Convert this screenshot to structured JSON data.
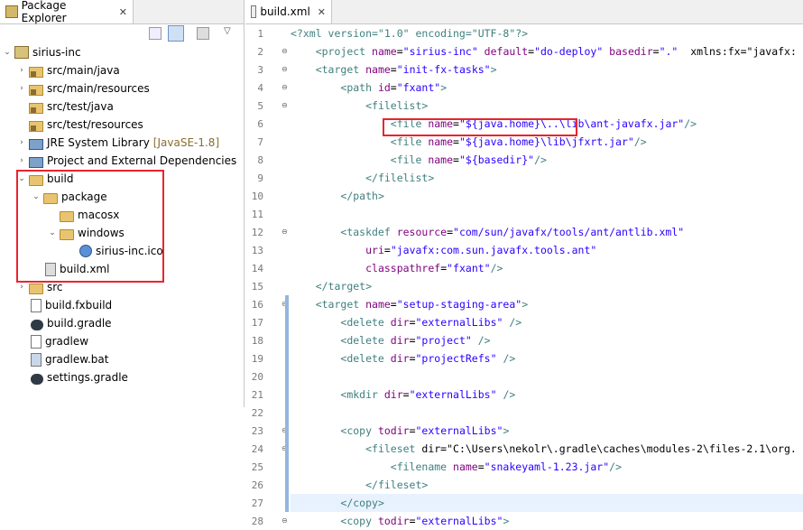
{
  "explorer": {
    "tab_label": "Package Explorer",
    "tab_close": "✕",
    "project": "sirius-inc",
    "items": [
      {
        "label": "src/main/java",
        "icon": "package-folder-icon",
        "chevron": "›"
      },
      {
        "label": "src/main/resources",
        "icon": "package-folder-icon",
        "chevron": "›"
      },
      {
        "label": "src/test/java",
        "icon": "package-folder-icon",
        "chevron": ""
      },
      {
        "label": "src/test/resources",
        "icon": "package-folder-icon",
        "chevron": ""
      },
      {
        "label": "JRE System Library",
        "suffix": "[JavaSE-1.8]",
        "icon": "library-icon",
        "chevron": "›"
      },
      {
        "label": "Project and External Dependencies",
        "icon": "library-icon",
        "chevron": "›"
      },
      {
        "label": "build",
        "icon": "folder-icon",
        "chevron": "⌄"
      },
      {
        "label": "package",
        "icon": "folder-icon",
        "chevron": "⌄"
      },
      {
        "label": "macosx",
        "icon": "folder-icon",
        "chevron": ""
      },
      {
        "label": "windows",
        "icon": "folder-icon",
        "chevron": "⌄"
      },
      {
        "label": "sirius-inc.ico",
        "icon": "ico-file-icon",
        "chevron": ""
      },
      {
        "label": "build.xml",
        "icon": "ant-file-icon",
        "chevron": ""
      },
      {
        "label": "src",
        "icon": "folder-icon",
        "chevron": "›"
      },
      {
        "label": "build.fxbuild",
        "icon": "file-icon",
        "chevron": ""
      },
      {
        "label": "build.gradle",
        "icon": "gradle-icon",
        "chevron": ""
      },
      {
        "label": "gradlew",
        "icon": "file-icon",
        "chevron": ""
      },
      {
        "label": "gradlew.bat",
        "icon": "bat-file-icon",
        "chevron": ""
      },
      {
        "label": "settings.gradle",
        "icon": "gradle-icon",
        "chevron": ""
      }
    ]
  },
  "editor": {
    "tab_label": "build.xml",
    "tab_close": "✕",
    "line_numbers": [
      "1",
      "2",
      "3",
      "4",
      "5",
      "6",
      "7",
      "8",
      "9",
      "10",
      "11",
      "12",
      "13",
      "14",
      "15",
      "16",
      "17",
      "18",
      "19",
      "20",
      "21",
      "22",
      "23",
      "24",
      "25",
      "26",
      "27",
      "28"
    ],
    "lines": [
      "<?xml version=\"1.0\" encoding=\"UTF-8\"?>",
      "    <project name=\"sirius-inc\" default=\"do-deploy\" basedir=\".\"  xmlns:fx=\"javafx:",
      "    <target name=\"init-fx-tasks\">",
      "        <path id=\"fxant\">",
      "            <filelist>",
      "                <file name=\"${java.home}\\..\\lib\\ant-javafx.jar\"/>",
      "                <file name=\"${java.home}\\lib\\jfxrt.jar\"/>",
      "                <file name=\"${basedir}\"/>",
      "            </filelist>",
      "        </path>",
      "",
      "        <taskdef resource=\"com/sun/javafx/tools/ant/antlib.xml\"",
      "            uri=\"javafx:com.sun.javafx.tools.ant\"",
      "            classpathref=\"fxant\"/>",
      "    </target>",
      "    <target name=\"setup-staging-area\">",
      "        <delete dir=\"externalLibs\" />",
      "        <delete dir=\"project\" />",
      "        <delete dir=\"projectRefs\" />",
      "",
      "        <mkdir dir=\"externalLibs\" />",
      "",
      "        <copy todir=\"externalLibs\">",
      "            <fileset dir=\"C:\\Users\\nekolr\\.gradle\\caches\\modules-2\\files-2.1\\org.",
      "                <filename name=\"snakeyaml-1.23.jar\"/>",
      "            </fileset>",
      "        </copy>",
      "        <copy todir=\"externalLibs\">"
    ]
  }
}
